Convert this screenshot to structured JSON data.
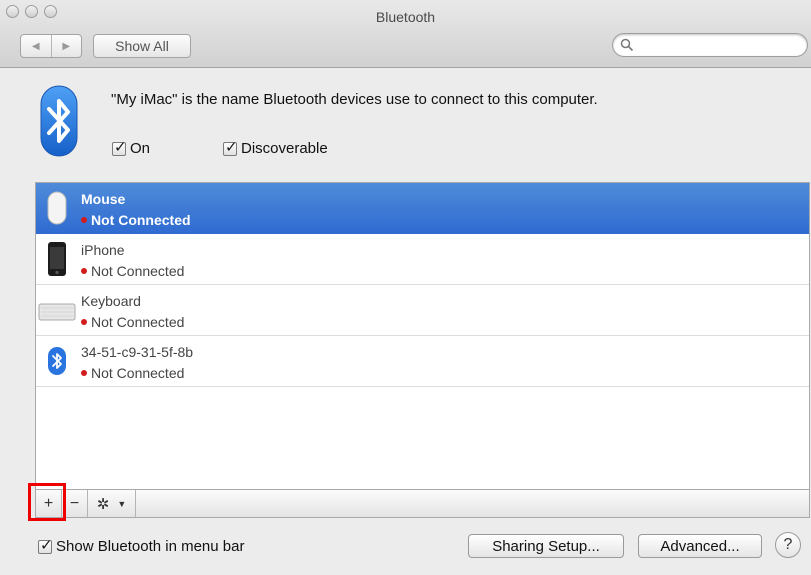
{
  "window": {
    "title": "Bluetooth"
  },
  "toolbar": {
    "back_icon": "back-arrow-icon",
    "forward_icon": "forward-arrow-icon",
    "show_all_label": "Show All",
    "search_placeholder": ""
  },
  "header": {
    "description": "\"My iMac\" is the name Bluetooth devices use to connect to this computer.",
    "on_label": "On",
    "on_checked": true,
    "discoverable_label": "Discoverable",
    "discoverable_checked": true
  },
  "devices": [
    {
      "name": "Mouse",
      "status": "Not Connected",
      "icon": "mouse-icon",
      "selected": true
    },
    {
      "name": "iPhone",
      "status": "Not Connected",
      "icon": "iphone-icon",
      "selected": false
    },
    {
      "name": "Keyboard",
      "status": "Not Connected",
      "icon": "keyboard-icon",
      "selected": false
    },
    {
      "name": "34-51-c9-31-5f-8b",
      "status": "Not Connected",
      "icon": "bluetooth-icon",
      "selected": false
    }
  ],
  "list_bar": {
    "add_label": "+",
    "remove_label": "−"
  },
  "footer": {
    "show_in_menubar_label": "Show Bluetooth in menu bar",
    "show_in_menubar_checked": true,
    "sharing_setup_label": "Sharing Setup...",
    "advanced_label": "Advanced...",
    "help_label": "?"
  },
  "colors": {
    "selection": "#3a74d6",
    "status_dot": "#d21b1b",
    "highlight": "#ee0000"
  }
}
